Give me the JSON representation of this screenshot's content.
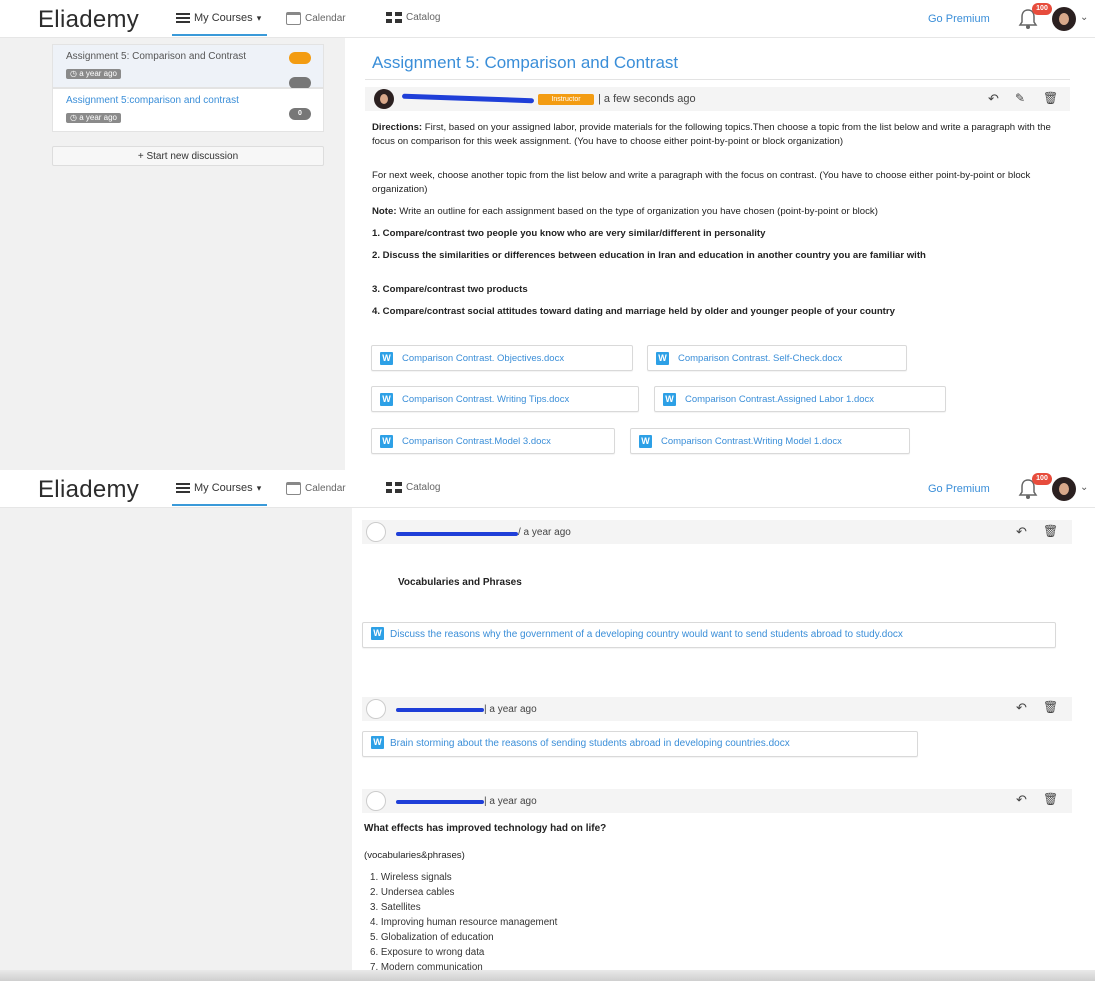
{
  "navbar": {
    "brand": "Eliademy",
    "my_courses": "My Courses",
    "calendar": "Calendar",
    "catalog": "Catalog",
    "go_premium": "Go Premium",
    "notif_count": "100"
  },
  "sidebar": {
    "discussions": [
      {
        "title": "Assignment 5: Comparison and Contrast",
        "time": "a year ago",
        "count": "",
        "active": true
      },
      {
        "title": "Assignment 5:comparison and contrast",
        "time": "a year ago",
        "count": "0",
        "active": false
      }
    ],
    "new_discussion": "+ Start new discussion"
  },
  "post": {
    "title": "Assignment 5: Comparison and Contrast",
    "badge": "Instructor",
    "meta": "| a few seconds ago",
    "directions_label": "Directions:",
    "directions": "First, based on your assigned labor, provide materials for the following topics.Then choose a topic from the list below and write a paragraph with the focus on comparison for this week assignment. (You have to choose either point-by-point or block organization)",
    "next_week": "For next week, choose another topic from the list below and write a paragraph with the focus on contrast. (You have to choose either point-by-point or block organization)",
    "note_label": "Note:",
    "note": "Write an outline for each assignment based on the type of organization you have chosen (point-by-point or block)",
    "topics": [
      "1. Compare/contrast two people you know who are very similar/different in personality",
      "2. Discuss the similarities or differences between education in Iran and education in another country you are familiar with",
      "3. Compare/contrast two products",
      "4. Compare/contrast social attitudes toward dating and marriage held by older and younger people of your country"
    ],
    "attachments": [
      "Comparison Contrast. Objectives.docx",
      "Comparison Contrast. Self-Check.docx",
      "Comparison Contrast. Writing Tips.docx",
      "Comparison Contrast.Assigned Labor 1.docx",
      "Comparison Contrast.Model 3.docx",
      "Comparison Contrast.Writing Model 1.docx"
    ]
  },
  "comments": [
    {
      "time": "/ a year ago",
      "heading": "Vocabularies and Phrases",
      "attachment": "Discuss the reasons why the government of a developing country would want to send students abroad to study.docx"
    },
    {
      "time": "| a year ago",
      "attachment": "Brain storming about the reasons of sending students abroad in developing countries.docx"
    },
    {
      "time": "| a year ago",
      "question": "What effects has improved technology had on life?",
      "sub": "(vocabularies&phrases)",
      "list": [
        "1. Wireless signals",
        "2. Undersea cables",
        "3. Satellites",
        "4. Improving human resource management",
        "5. Globalization of education",
        "6. Exposure to wrong data",
        "7. Modern communication"
      ]
    }
  ],
  "colors": {
    "accent": "#3a8ed8",
    "badge": "#f39c12",
    "notif": "#e74c3c"
  }
}
